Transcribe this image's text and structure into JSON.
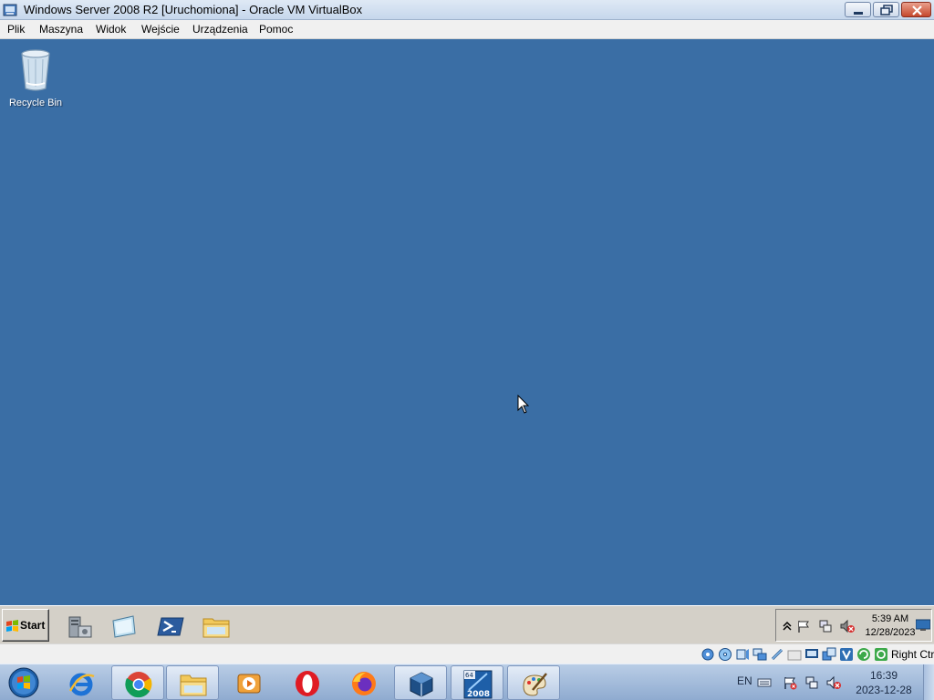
{
  "window": {
    "title": "Windows Server 2008 R2 [Uruchomiona] - Oracle VM VirtualBox",
    "icon": "virtualbox-app-icon",
    "controls": [
      "minimize-icon",
      "restore-icon",
      "close-icon"
    ]
  },
  "menubar": {
    "items": [
      "Plik",
      "Maszyna",
      "Widok",
      "Wejście",
      "Urządzenia",
      "Pomoc"
    ]
  },
  "desktop": {
    "background_color": "#3a6ea5",
    "icons": [
      {
        "label": "Recycle Bin",
        "icon": "recycle-bin-icon"
      }
    ]
  },
  "guest_taskbar": {
    "start_label": "Start",
    "quick_launch": [
      "server-manager-icon",
      "show-desktop-icon",
      "powershell-icon",
      "explorer-folder-icon"
    ],
    "tray": {
      "icons": [
        "show-hidden-icon",
        "action-center-flag-icon",
        "network-icon",
        "volume-muted-icon"
      ],
      "time": "5:39 AM",
      "date": "12/28/2023"
    }
  },
  "statusbar": {
    "icons": [
      "hard-disk-icon",
      "optical-drive-icon",
      "audio-icon",
      "network-adapter-icon",
      "usb-icon",
      "shared-folders-icon",
      "display-icon",
      "video-capture-icon",
      "virtualization-icon",
      "guest-additions-icon",
      "mouse-integration-icon"
    ],
    "host_key": "Right Ctrl"
  },
  "host_taskbar": {
    "apps": [
      {
        "name": "internet-explorer-icon",
        "active": false
      },
      {
        "name": "chrome-icon",
        "active": true
      },
      {
        "name": "file-explorer-icon",
        "active": true
      },
      {
        "name": "media-player-icon",
        "active": false
      },
      {
        "name": "opera-icon",
        "active": false
      },
      {
        "name": "firefox-icon",
        "active": false
      },
      {
        "name": "virtualbox-icon",
        "active": true
      },
      {
        "name": "server-2008-vm-icon",
        "active": true
      },
      {
        "name": "paint-icon",
        "active": true
      }
    ],
    "vm_badge_top": "64",
    "vm_badge_bottom": "2008",
    "language": "EN",
    "tray_icons": [
      "keyboard-icon",
      "action-center-flag-icon",
      "network-icon",
      "volume-muted-icon"
    ],
    "time": "16:39",
    "date": "2023-12-28"
  }
}
